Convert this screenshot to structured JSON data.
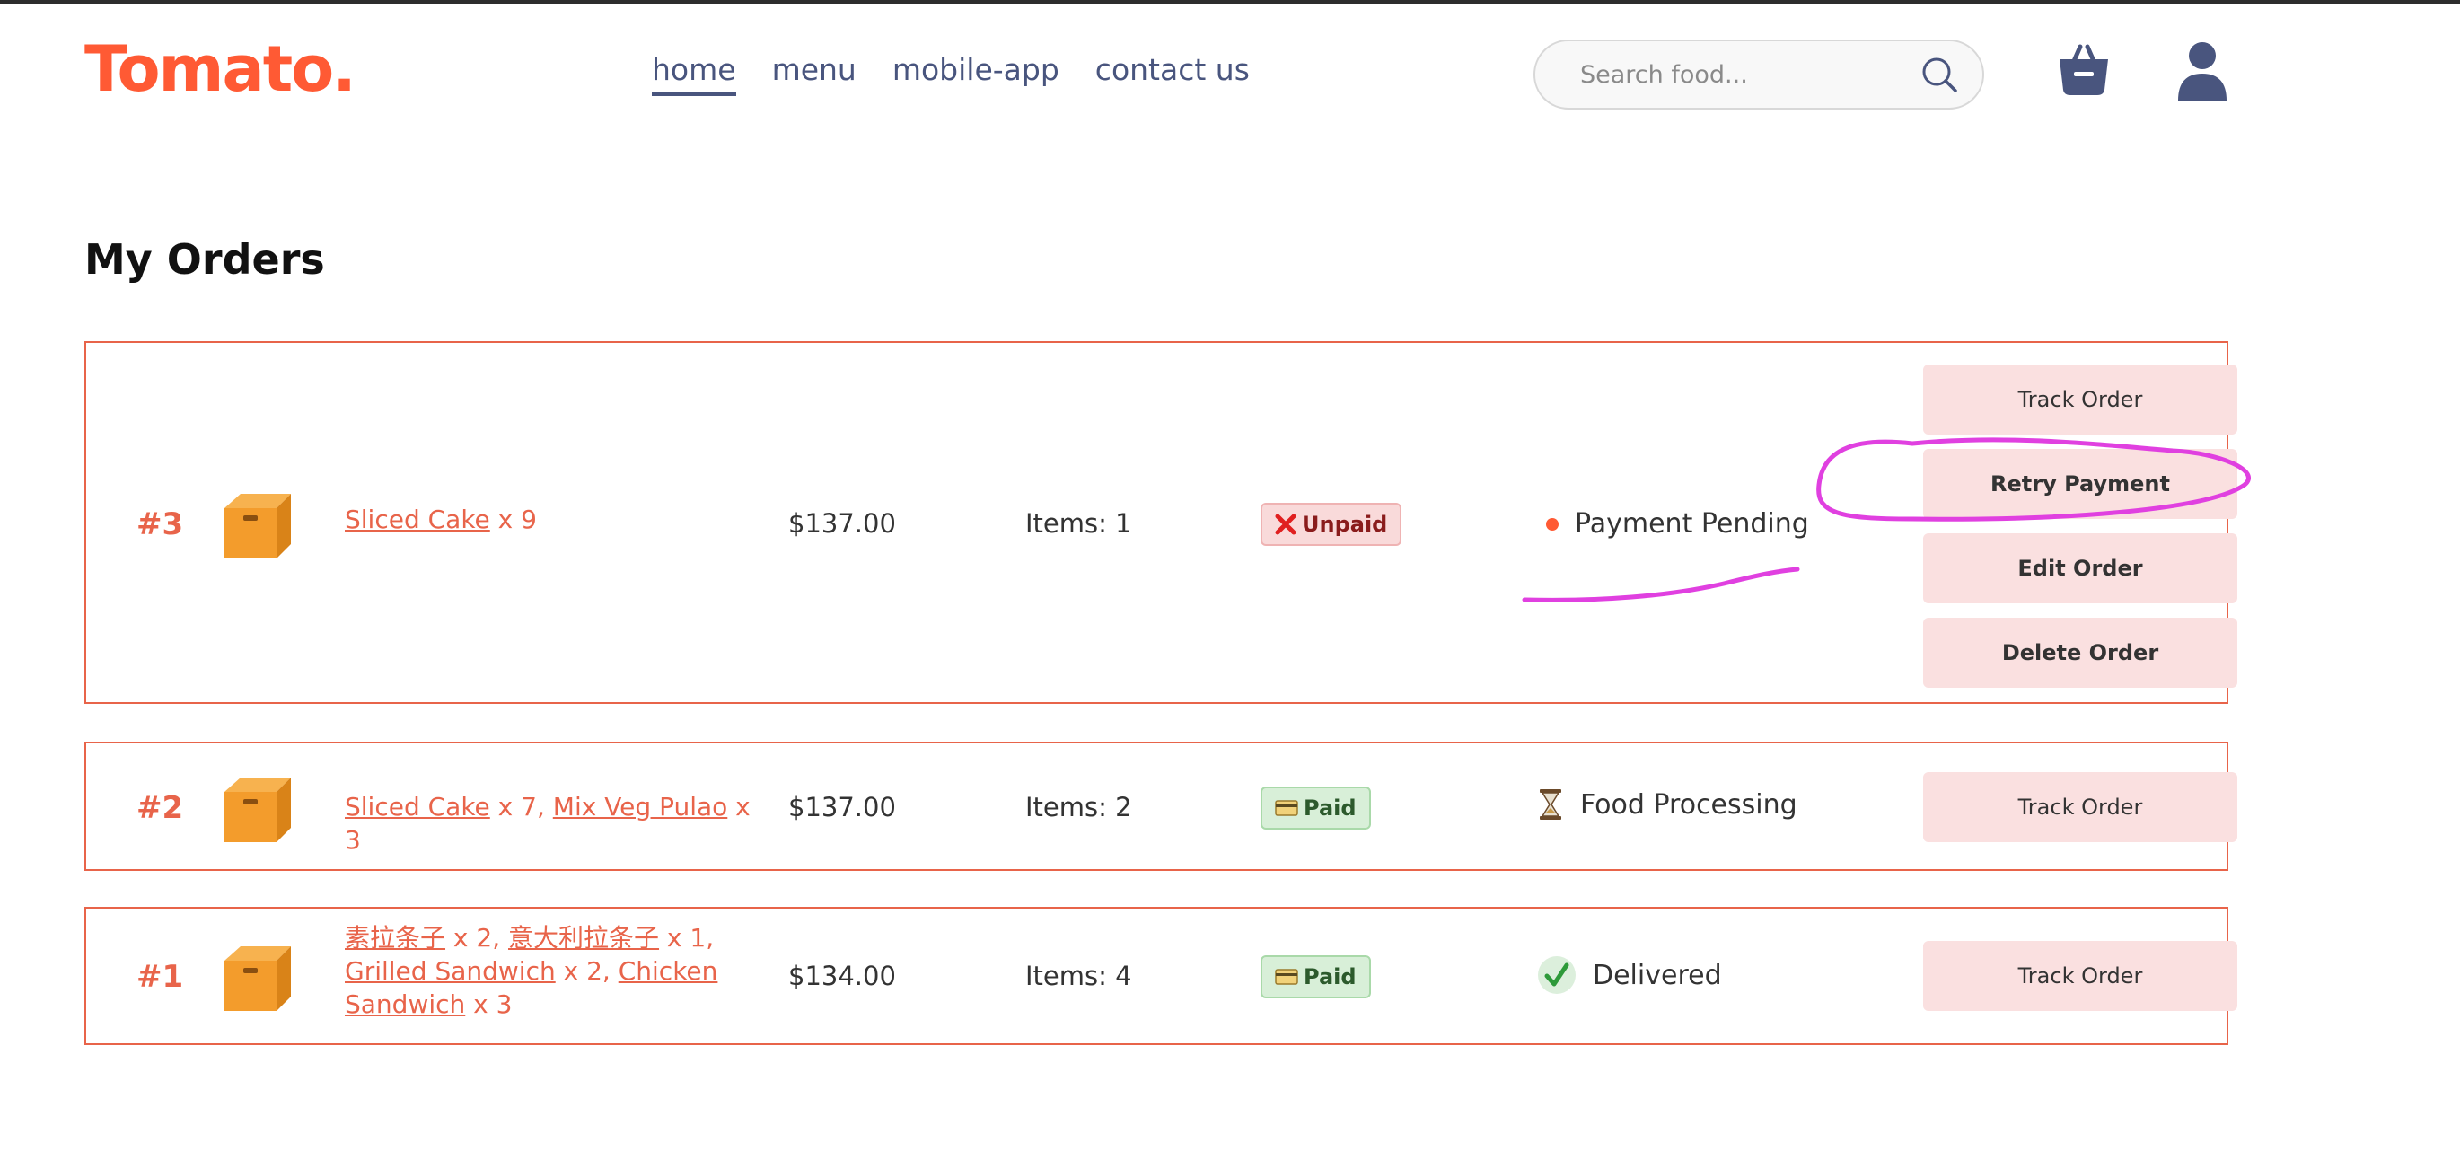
{
  "brand": {
    "logo": "Tomato."
  },
  "nav": {
    "items": [
      {
        "label": "home",
        "active": true
      },
      {
        "label": "menu"
      },
      {
        "label": "mobile-app"
      },
      {
        "label": "contact us"
      }
    ]
  },
  "search": {
    "placeholder": "Search food..."
  },
  "icons": {
    "search": "search-icon",
    "basket": "basket-icon",
    "profile": "profile-icon",
    "box": "box-icon",
    "unpaid": "x-mark-icon",
    "paid": "card-icon",
    "processing": "hourglass-icon",
    "delivered": "checkmark-icon"
  },
  "colors": {
    "brand": "#ff5a34",
    "border": "#e8644a",
    "button_bg": "#fae0e0",
    "annotation": "#e040e0"
  },
  "page": {
    "title": "My Orders"
  },
  "orders": [
    {
      "id": "#3",
      "items": [
        {
          "name": "Sliced Cake",
          "qty": " x 9"
        }
      ],
      "amount": "$137.00",
      "count": "Items: 1",
      "payment": "Unpaid",
      "status": "Payment Pending",
      "buttons": [
        "Track Order",
        "Retry Payment",
        "Edit Order",
        "Delete Order"
      ]
    },
    {
      "id": "#2",
      "items": [
        {
          "name": "Sliced Cake",
          "qty": " x 7, "
        },
        {
          "name": "Mix Veg Pulao",
          "qty": " x 3"
        }
      ],
      "amount": "$137.00",
      "count": "Items: 2",
      "payment": "Paid",
      "status": "Food Processing",
      "buttons": [
        "Track Order"
      ]
    },
    {
      "id": "#1",
      "items": [
        {
          "name": "素拉条子",
          "qty": " x 2, "
        },
        {
          "name": "意大利拉条子",
          "qty": " x 1, "
        },
        {
          "name": "Grilled Sandwich",
          "qty": " x 2, "
        },
        {
          "name": "Chicken Sandwich",
          "qty": " x 3"
        }
      ],
      "amount": "$134.00",
      "count": "Items: 4",
      "payment": "Paid",
      "status": "Delivered",
      "buttons": [
        "Track Order"
      ]
    }
  ]
}
